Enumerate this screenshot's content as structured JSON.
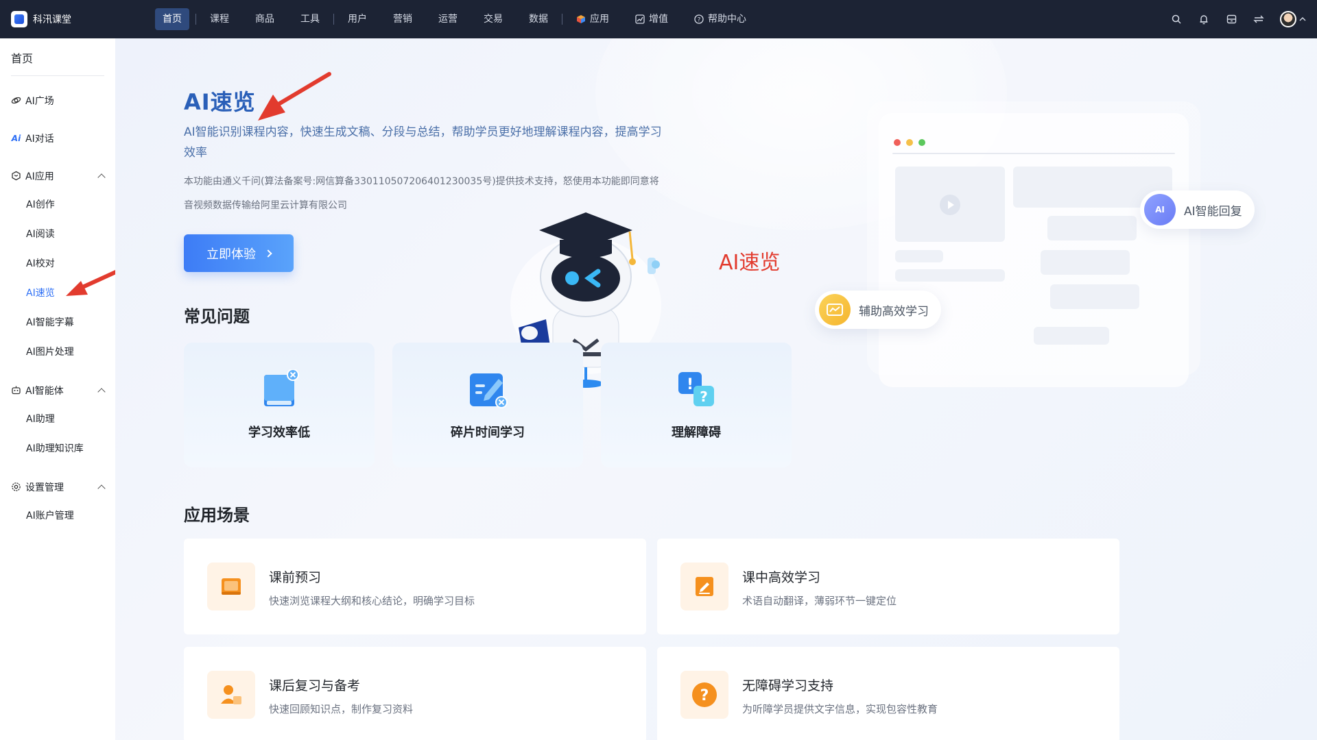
{
  "topbar": {
    "brand": "科汛课堂",
    "nav": [
      {
        "label": "首页",
        "active": true
      },
      {
        "label": "课程"
      },
      {
        "label": "商品"
      },
      {
        "label": "工具"
      },
      {
        "label": "用户"
      },
      {
        "label": "营销"
      },
      {
        "label": "运营"
      },
      {
        "label": "交易"
      },
      {
        "label": "数据"
      },
      {
        "label": "应用",
        "icon": "cube-icon"
      },
      {
        "label": "增值",
        "icon": "trend-icon"
      },
      {
        "label": "帮助中心",
        "icon": "help-icon"
      }
    ],
    "right_icons": [
      "search-icon",
      "bell-icon",
      "inbox-icon",
      "switch-icon",
      "avatar"
    ]
  },
  "sidebar": {
    "home": "首页",
    "plaza": "AI广场",
    "chat": "AI对话",
    "apps": {
      "label": "AI应用",
      "items": [
        "AI创作",
        "AI阅读",
        "AI校对",
        "AI速览",
        "AI智能字幕",
        "AI图片处理"
      ],
      "active": "AI速览"
    },
    "agents": {
      "label": "AI智能体",
      "items": [
        "AI助理",
        "AI助理知识库"
      ]
    },
    "settings": {
      "label": "设置管理",
      "items": [
        "AI账户管理"
      ]
    }
  },
  "hero": {
    "title": "AI速览",
    "desc": "AI智能识别课程内容，快速生成文稿、分段与总结，帮助学员更好地理解课程内容，提高学习效率",
    "note": "本功能由通义千问(算法备案号:网信算备330110507206401230035号)提供技术支持，怒使用本功能即同意将音视频数据传输给阿里云计算有限公司",
    "button": "立即体验",
    "annotation": "AI速览"
  },
  "faq": {
    "title": "常见问题",
    "items": [
      {
        "label": "学习效率低",
        "icon": "book-icon"
      },
      {
        "label": "碎片时间学习",
        "icon": "edit-icon"
      },
      {
        "label": "理解障碍",
        "icon": "question-bubble-icon"
      }
    ]
  },
  "scenes": {
    "title": "应用场景",
    "items": [
      {
        "title": "课前预习",
        "desc": "快速浏览课程大纲和核心结论，明确学习目标",
        "icon": "book-stack-icon"
      },
      {
        "title": "课中高效学习",
        "desc": "术语自动翻译，薄弱环节一键定位",
        "icon": "pencil-note-icon"
      },
      {
        "title": "课后复习与备考",
        "desc": "快速回顾知识点，制作复习资料",
        "icon": "user-note-icon"
      },
      {
        "title": "无障碍学习支持",
        "desc": "为听障学员提供文字信息，实现包容性教育",
        "icon": "question-circle-icon"
      }
    ]
  },
  "illustration": {
    "reply_pill": "AI智能回复",
    "reply_icon_text": "AI",
    "study_pill": "辅助高效学习"
  },
  "colors": {
    "topbar": "#1c2334",
    "accent": "#2d6ff5",
    "annotation": "#e23b2e",
    "scene_icon": "#f5901e"
  }
}
